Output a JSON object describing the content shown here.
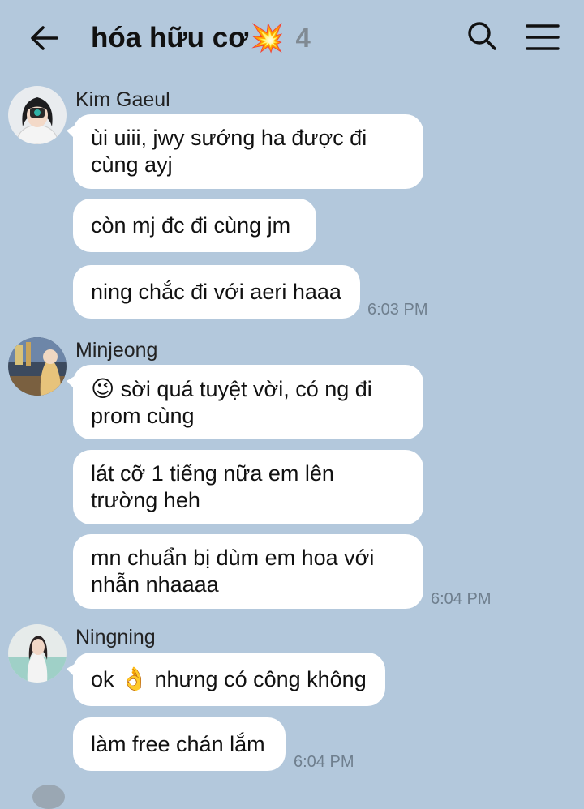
{
  "header": {
    "title": "hóa hữu cơ",
    "title_emoji": "💥",
    "member_count": "4"
  },
  "groups": [
    {
      "sender": "Kim Gaeul",
      "messages": [
        "ùi uiii, jwy sướng ha được đi\ncùng ayj",
        "còn mj đc đi cùng jm",
        "ning chắc đi với aeri haaa"
      ],
      "time": "6:03 PM"
    },
    {
      "sender": "Minjeong",
      "messages": [
        "sời quá tuyệt vời, có ng đi\nprom cùng",
        "lát cỡ 1 tiếng nữa em lên\ntrường heh",
        "mn chuẩn bị dùm em hoa với\nnhẫn nhaaaa"
      ],
      "time": "6:04 PM"
    },
    {
      "sender": "Ningning",
      "messages": [
        "nhưng có công không",
        "làm free chán lắm"
      ],
      "time": "6:04 PM"
    }
  ],
  "emojis": {
    "wink": "😉",
    "ok_hand": "👌",
    "ok_prefix": "ok"
  },
  "colors": {
    "background": "#b3c8dc",
    "bubble": "#ffffff",
    "timestamp": "#6f7f8e"
  },
  "icons": [
    "back-arrow-icon",
    "search-icon",
    "menu-icon"
  ]
}
